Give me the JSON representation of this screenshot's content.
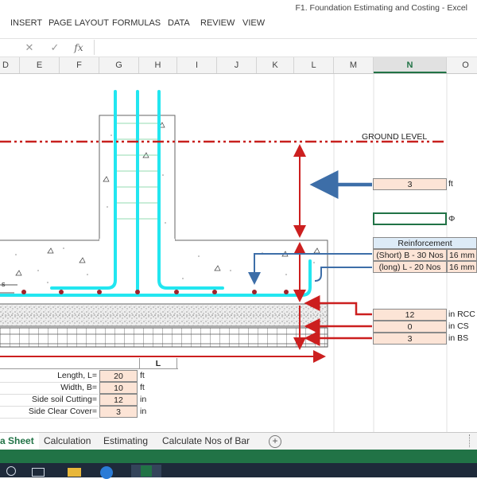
{
  "window": {
    "title": "F1. Foundation Estimating and Costing - Excel"
  },
  "ribbon": {
    "tabs": [
      "INSERT",
      "PAGE LAYOUT",
      "FORMULAS",
      "DATA",
      "REVIEW",
      "VIEW"
    ]
  },
  "formula_bar": {
    "cancel": "✕",
    "confirm": "✓",
    "fx": "fx",
    "value": ""
  },
  "columns": [
    "D",
    "E",
    "F",
    "G",
    "H",
    "I",
    "J",
    "K",
    "L",
    "M",
    "N",
    "O"
  ],
  "selected_column": "N",
  "drawing": {
    "ground_level_label": "GROUND LEVEL",
    "depth_value": "3",
    "depth_unit": "ft",
    "diameter_value": "",
    "diameter_symbol": "Φ",
    "reinforcement_header": "Reinforcement",
    "short_bar": "(Short) B - 30 Nos",
    "short_size": "16 mm",
    "long_bar": "(long) L - 20 Nos",
    "long_size": "16 mm",
    "layers": [
      {
        "value": "12",
        "unit": "in RCC"
      },
      {
        "value": "0",
        "unit": "in CS"
      },
      {
        "value": "3",
        "unit": "in BS"
      }
    ],
    "small_label": "s",
    "colors": {
      "rebar": "#22e6f0",
      "arrow": "#cc1f1f",
      "pointer": "#3d6ea8",
      "ground_line": "#c8201e"
    }
  },
  "inputs": {
    "header": "L",
    "rows": [
      {
        "label": "Length, L=",
        "value": "20",
        "unit": "ft"
      },
      {
        "label": "Width, B=",
        "value": "10",
        "unit": "ft"
      },
      {
        "label": "Side soil Cutting=",
        "value": "12",
        "unit": "in"
      },
      {
        "label": "Side Clear Cover=",
        "value": "3",
        "unit": "in"
      }
    ]
  },
  "sheet_tabs": [
    "a Sheet",
    "Calculation",
    "Estimating",
    "Calculate Nos of Bar"
  ],
  "add_sheet": "+"
}
